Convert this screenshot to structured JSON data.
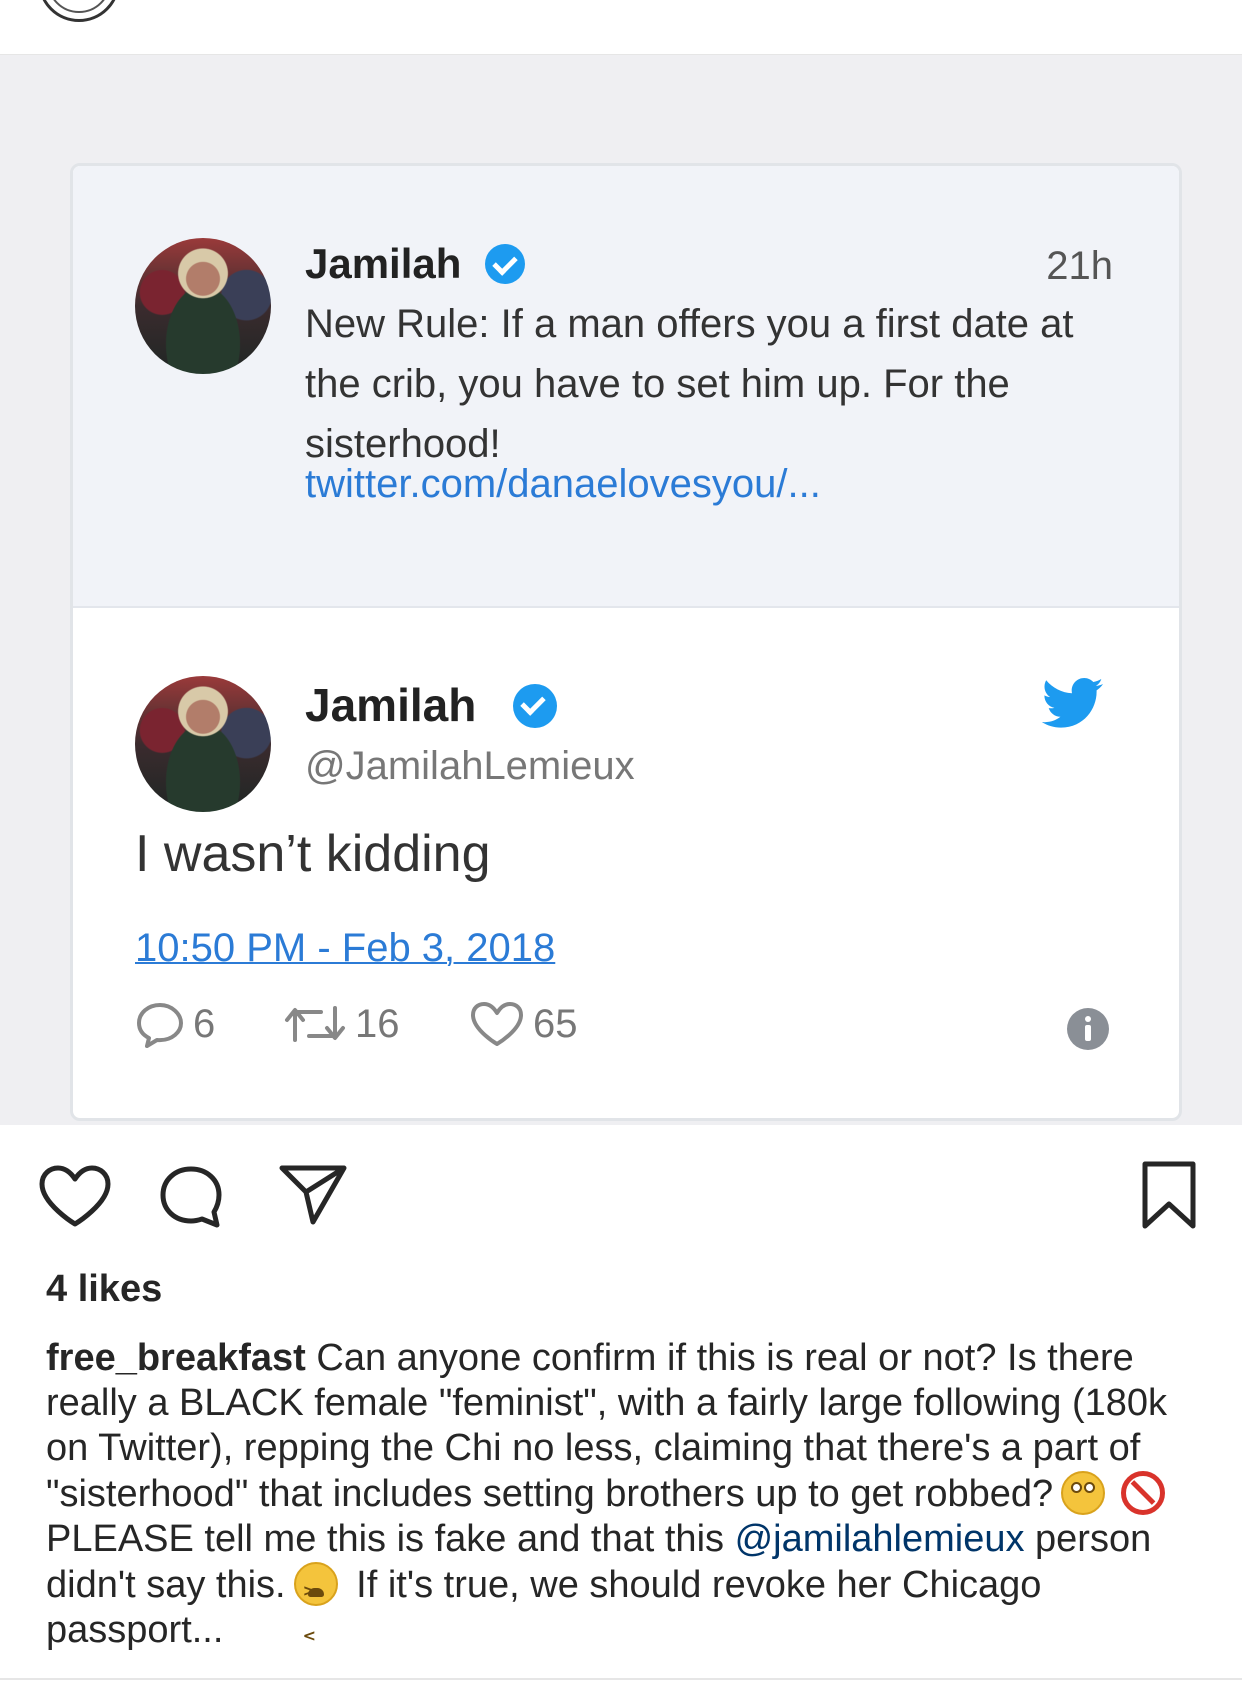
{
  "quoted_tweet": {
    "name": "Jamilah",
    "time": "21h",
    "text": "New Rule: If a man offers you a first date at the crib, you have to set him up. For the sisterhood!",
    "link": "twitter.com/danaelovesyou/..."
  },
  "main_tweet": {
    "name": "Jamilah",
    "handle": "@JamilahLemieux",
    "text": "I wasn’t kidding",
    "date": "10:50 PM - Feb 3, 2018",
    "replies": "6",
    "retweets": "16",
    "likes": "65"
  },
  "post": {
    "likes": "4 likes",
    "username": "free_breakfast",
    "caption_part1": " Can anyone confirm if this is real or not? Is there really a BLACK female \"feminist\", with a fairly large following (180k on Twitter), repping the Chi no less, claiming that there's a part of \"sisterhood\" that includes setting brothers up to get robbed?",
    "caption_part2": " PLEASE tell me this is fake and that this ",
    "mention": "@jamilahlemieux",
    "caption_part3": " person didn't say this.",
    "caption_part4": " If it's true, we should revoke her Chicago passport..."
  },
  "colors": {
    "accent_blue": "#1d9bf0",
    "link_blue": "#2b7bd6",
    "mention_blue": "#003569"
  },
  "icons": [
    "verified-badge-icon",
    "twitter-bird-icon",
    "reply-icon",
    "retweet-icon",
    "heart-icon",
    "info-icon",
    "comment-icon",
    "share-icon",
    "bookmark-icon",
    "eye-roll-emoji",
    "no-entry-emoji",
    "tired-face-emoji"
  ]
}
